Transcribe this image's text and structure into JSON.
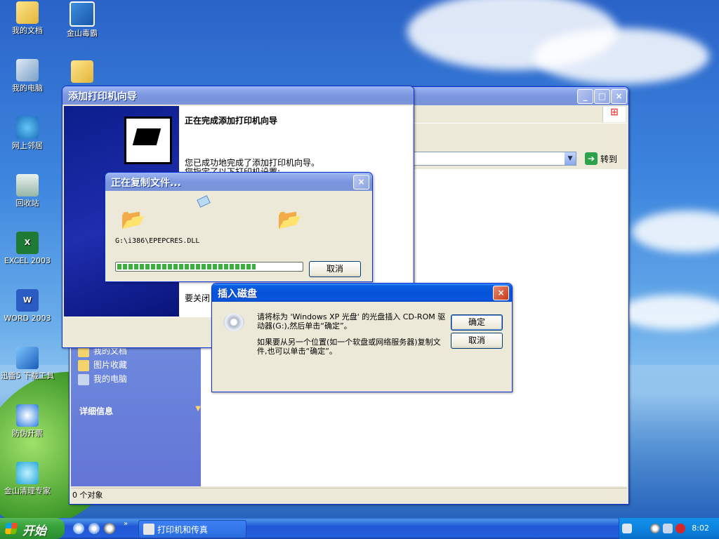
{
  "desktop": {
    "icons": [
      {
        "label": "我的文档"
      },
      {
        "label": "金山毒霸"
      },
      {
        "label": "我的电脑"
      },
      {
        "label": "网上邻居"
      },
      {
        "label": "回收站"
      },
      {
        "label": "EXCEL 2003"
      },
      {
        "label": "WORD 2003"
      },
      {
        "label": "迅雷5 下载工具"
      },
      {
        "label": "防伪开票"
      },
      {
        "label": "金山清理专家"
      }
    ]
  },
  "explorer": {
    "title": "打印机和传真",
    "go_label": "转到",
    "tasks": [
      "我的文档",
      "图片收藏",
      "我的电脑"
    ],
    "details_label": "详细信息",
    "status": "0 个对象"
  },
  "wizard": {
    "title": "添加打印机向导",
    "heading": "正在完成添加打印机向导",
    "done_text": "您已成功地完成了添加打印机向导。",
    "settings_text": "您指定了以下打印机设置:",
    "close_text": "要关闭"
  },
  "copy_dialog": {
    "title": "正在复制文件...",
    "file_path": "G:\\i386\\EPEPCRES.DLL",
    "progress": 0.74,
    "cancel_label": "取消"
  },
  "disk_dialog": {
    "title": "插入磁盘",
    "message1": "请将标为 'Windows XP 光盘' 的光盘插入 CD-ROM 驱动器(G:),然后单击“确定”。",
    "message2": "如果要从另一个位置(如一个软盘或网络服务器)复制文件,也可以单击“确定”。",
    "ok_label": "确定",
    "cancel_label": "取消"
  },
  "taskbar": {
    "start_label": "开始",
    "quicklaunch_more": "»",
    "task_button_label": "打印机和传真",
    "clock": "8:02"
  },
  "colors": {
    "xp_titlebar": "#0653d8",
    "taskbar": "#245edb",
    "start_button": "#36a33a",
    "progress": "#37b13a"
  }
}
